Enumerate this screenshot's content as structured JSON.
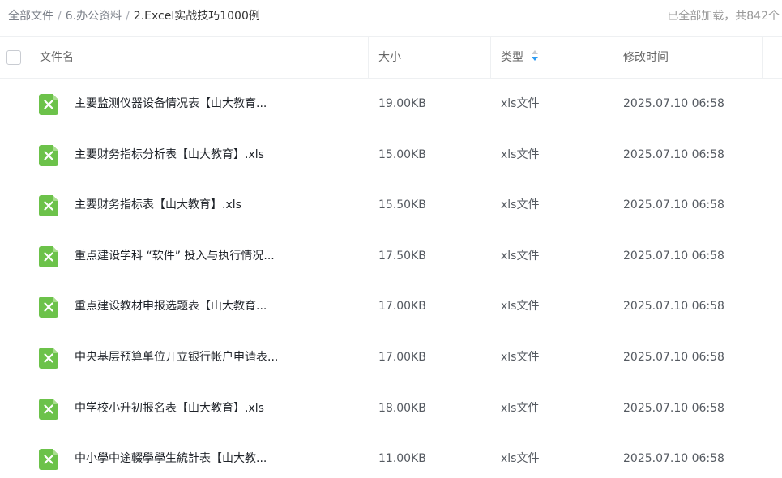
{
  "breadcrumb": {
    "items": [
      "全部文件",
      "6.办公资料"
    ],
    "separator": "/",
    "current": "2.Excel实战技巧1000例"
  },
  "status": {
    "text": "已全部加载，共842个"
  },
  "table": {
    "headers": {
      "name": "文件名",
      "size": "大小",
      "type": "类型",
      "modified": "修改时间"
    },
    "sorted_column": "type",
    "rows": [
      {
        "name": "主要监测仪器设备情况表【山大教育...",
        "size": "19.00KB",
        "type": "xls文件",
        "modified": "2025.07.10 06:58"
      },
      {
        "name": "主要财务指标分析表【山大教育】.xls",
        "size": "15.00KB",
        "type": "xls文件",
        "modified": "2025.07.10 06:58"
      },
      {
        "name": "主要财务指标表【山大教育】.xls",
        "size": "15.50KB",
        "type": "xls文件",
        "modified": "2025.07.10 06:58"
      },
      {
        "name": "重点建设学科 “软件” 投入与执行情况...",
        "size": "17.50KB",
        "type": "xls文件",
        "modified": "2025.07.10 06:58"
      },
      {
        "name": "重点建设教材申报选题表【山大教育...",
        "size": "17.00KB",
        "type": "xls文件",
        "modified": "2025.07.10 06:58"
      },
      {
        "name": "中央基层预算单位开立银行帐户申请表...",
        "size": "17.00KB",
        "type": "xls文件",
        "modified": "2025.07.10 06:58"
      },
      {
        "name": "中学校小升初报名表【山大教育】.xls",
        "size": "18.00KB",
        "type": "xls文件",
        "modified": "2025.07.10 06:58"
      },
      {
        "name": "中小學中途輟學學生統計表【山大教...",
        "size": "11.00KB",
        "type": "xls文件",
        "modified": "2025.07.10 06:58"
      }
    ]
  },
  "icons": {
    "row": "excel-file-icon",
    "sort": "sort-arrows-icon"
  },
  "colors": {
    "excel_green": "#6cc24a",
    "sort_active": "#2e9cf3"
  }
}
